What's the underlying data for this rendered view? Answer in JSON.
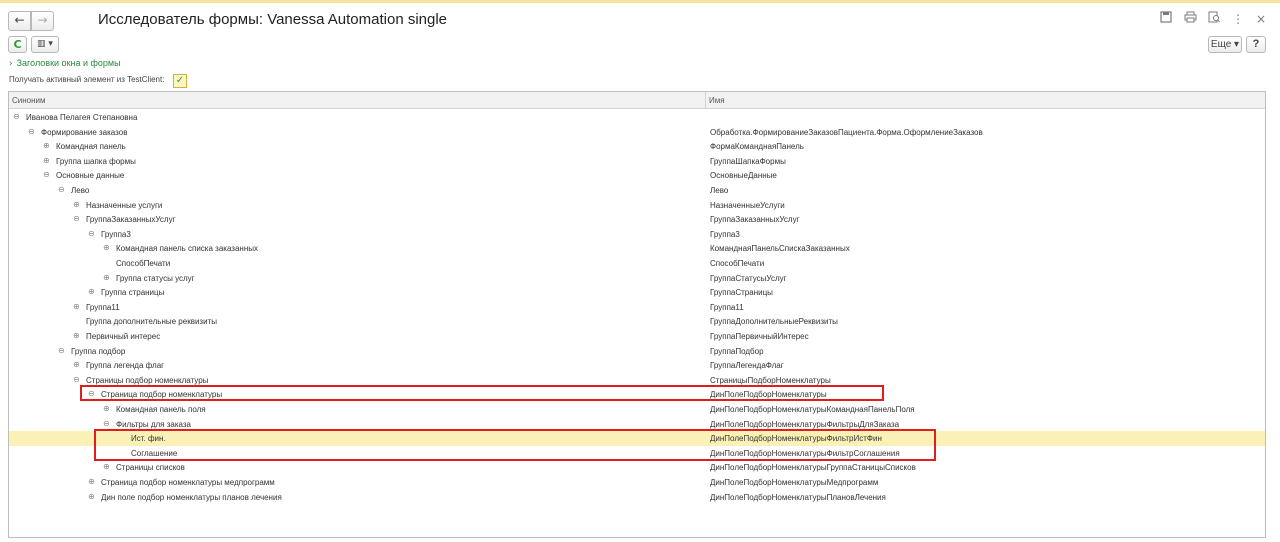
{
  "window": {
    "title": "Исследователь формы: Vanessa Automation single",
    "back_icon": "←",
    "forward_icon": "→",
    "icons": [
      "save-icon",
      "print-icon",
      "preview-icon",
      "more-icon",
      "close-icon"
    ]
  },
  "toolbar": {
    "refresh_icon": "C",
    "view_icon": "▥ ▾",
    "more_label": "Еще ▾",
    "help_label": "?"
  },
  "section": {
    "chevron": "›",
    "title": "Заголовки окна и формы"
  },
  "active_element": {
    "label": "Получать активный элемент из TestClient:",
    "checked": true,
    "check_glyph": "✓"
  },
  "grid": {
    "columns": [
      "Синоним",
      "Имя"
    ],
    "rows": [
      {
        "level": 0,
        "exp": "⊖",
        "synonym": "Иванова Пелагея Степановна",
        "name": ""
      },
      {
        "level": 1,
        "exp": "⊖",
        "synonym": "Формирование заказов",
        "name": "Обработка.ФормированиеЗаказовПациента.Форма.ОформлениеЗаказов"
      },
      {
        "level": 2,
        "exp": "⊕",
        "synonym": "Командная панель",
        "name": "ФормаКоманднаяПанель"
      },
      {
        "level": 2,
        "exp": "⊕",
        "synonym": "Группа шапка формы",
        "name": "ГруппаШапкаФормы"
      },
      {
        "level": 2,
        "exp": "⊖",
        "synonym": "Основные данные",
        "name": "ОсновныеДанные"
      },
      {
        "level": 3,
        "exp": "⊖",
        "synonym": "Лево",
        "name": "Лево"
      },
      {
        "level": 4,
        "exp": "⊕",
        "synonym": "Назначенные услуги",
        "name": "НазначенныеУслуги"
      },
      {
        "level": 4,
        "exp": "⊖",
        "synonym": "ГруппаЗаказанныхУслуг",
        "name": "ГруппаЗаказанныхУслуг"
      },
      {
        "level": 5,
        "exp": "⊖",
        "synonym": "Группа3",
        "name": "Группа3"
      },
      {
        "level": 6,
        "exp": "⊕",
        "synonym": "Командная панель списка заказанных",
        "name": "КоманднаяПанельСпискаЗаказанных"
      },
      {
        "level": 6,
        "exp": "",
        "synonym": "СпособПечати",
        "name": "СпособПечати"
      },
      {
        "level": 6,
        "exp": "⊕",
        "synonym": "Группа статусы услуг",
        "name": "ГруппаСтатусыУслуг"
      },
      {
        "level": 5,
        "exp": "⊕",
        "synonym": "Группа страницы",
        "name": "ГруппаСтраницы"
      },
      {
        "level": 4,
        "exp": "⊕",
        "synonym": "Группа11",
        "name": "Группа11"
      },
      {
        "level": 4,
        "exp": "",
        "synonym": "Группа дополнительные реквизиты",
        "name": "ГруппаДополнительныеРеквизиты"
      },
      {
        "level": 4,
        "exp": "⊕",
        "synonym": "Первичный интерес",
        "name": "ГруппаПервичныйИнтерес"
      },
      {
        "level": 3,
        "exp": "⊖",
        "synonym": "Группа подбор",
        "name": "ГруппаПодбор"
      },
      {
        "level": 4,
        "exp": "⊕",
        "synonym": "Группа легенда флаг",
        "name": "ГруппаЛегендаФлаг"
      },
      {
        "level": 4,
        "exp": "⊖",
        "synonym": "Страницы подбор номенклатуры",
        "name": "СтраницыПодборНоменклатуры"
      },
      {
        "level": 5,
        "exp": "⊖",
        "synonym": "Страница подбор номенклатуры",
        "name": "ДинПолеПодборНоменклатуры"
      },
      {
        "level": 6,
        "exp": "⊕",
        "synonym": "Командная панель поля",
        "name": "ДинПолеПодборНоменклатурыКоманднаяПанельПоля"
      },
      {
        "level": 6,
        "exp": "⊖",
        "synonym": "Фильтры для заказа",
        "name": "ДинПолеПодборНоменклатурыФильтрыДляЗаказа"
      },
      {
        "level": 7,
        "exp": "",
        "synonym": "Ист. фин.",
        "name": "ДинПолеПодборНоменклатурыФильтрИстФин",
        "selected": true
      },
      {
        "level": 7,
        "exp": "",
        "synonym": "Соглашение",
        "name": "ДинПолеПодборНоменклатурыФильтрСоглашения"
      },
      {
        "level": 6,
        "exp": "⊕",
        "synonym": "Страницы списков",
        "name": "ДинПолеПодборНоменклатурыГруппаСтаницыСписков"
      },
      {
        "level": 5,
        "exp": "⊕",
        "synonym": "Страница подбор номенклатуры медпрограмм",
        "name": "ДинПолеПодборНоменклатурыМедпрограмм"
      },
      {
        "level": 5,
        "exp": "⊕",
        "synonym": "Дин поле подбор номенклатуры планов лечения",
        "name": "ДинПолеПодборНоменклатурыПлановЛечения"
      }
    ]
  }
}
